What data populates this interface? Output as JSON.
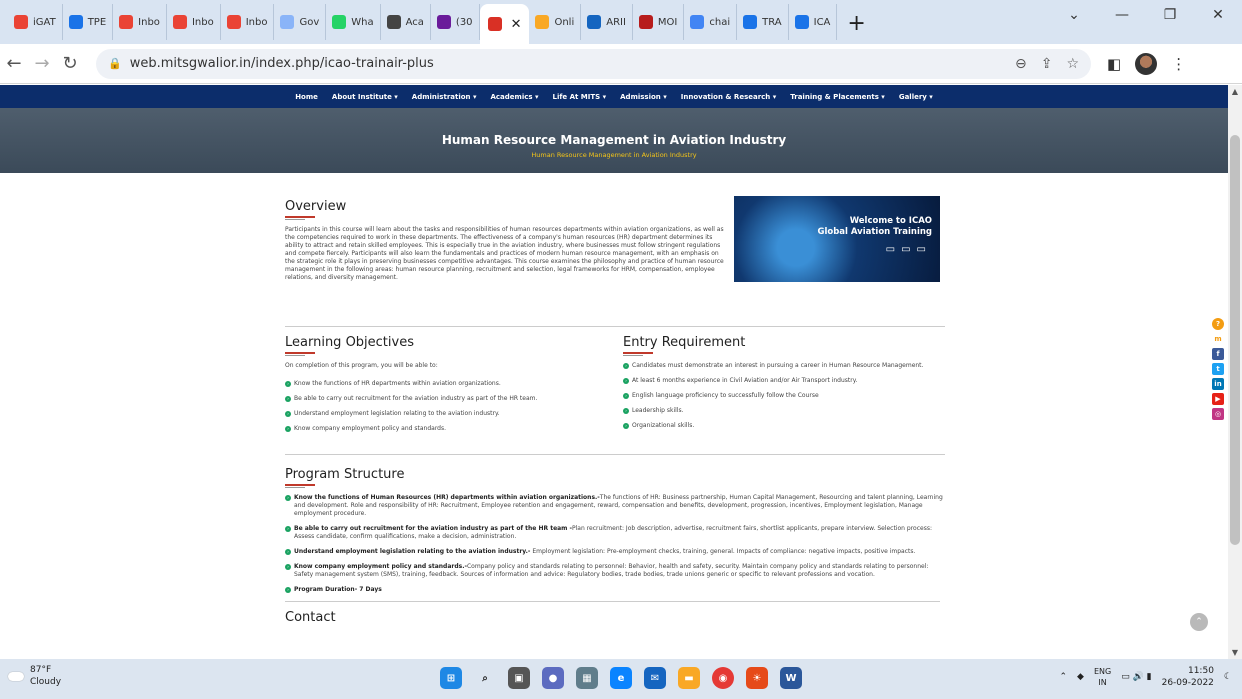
{
  "browser": {
    "tabs": [
      {
        "label": "iGAT",
        "icon": "gmail-icon",
        "color": "#ea4335"
      },
      {
        "label": "TPE",
        "icon": "site-icon",
        "color": "#1a73e8"
      },
      {
        "label": "Inbo",
        "icon": "gmail-icon",
        "color": "#ea4335"
      },
      {
        "label": "Inbo",
        "icon": "gmail-icon",
        "color": "#ea4335"
      },
      {
        "label": "Inbo",
        "icon": "gmail-icon",
        "color": "#ea4335"
      },
      {
        "label": "Gov",
        "icon": "site-icon",
        "color": "#8ab4f8"
      },
      {
        "label": "Wha",
        "icon": "whatsapp-icon",
        "color": "#25d366"
      },
      {
        "label": "Aca",
        "icon": "site-icon",
        "color": "#444"
      },
      {
        "label": "(30",
        "icon": "mail-icon",
        "color": "#6a1b9a"
      }
    ],
    "active_tab": {
      "label": "",
      "icon": "opera-icon",
      "color": "#d93025"
    },
    "tabs_after": [
      {
        "label": "Onli",
        "icon": "site-icon",
        "color": "#f9a825"
      },
      {
        "label": "ARII",
        "icon": "site-icon",
        "color": "#1565c0"
      },
      {
        "label": "MOI",
        "icon": "site-icon",
        "color": "#b71c1c"
      },
      {
        "label": "chai",
        "icon": "google-icon",
        "color": "#4285f4"
      },
      {
        "label": "TRA",
        "icon": "site-icon",
        "color": "#1a73e8"
      },
      {
        "label": "ICA",
        "icon": "site-icon",
        "color": "#1a73e8"
      }
    ],
    "url": "web.mitsgwalior.in/index.php/icao-trainair-plus"
  },
  "site": {
    "nav": [
      "Home",
      "About Institute ▾",
      "Administration ▾",
      "Academics ▾",
      "Life At MITS ▾",
      "Admission ▾",
      "Innovation & Research ▾",
      "Training & Placements ▾",
      "Gallery ▾"
    ],
    "hero_title": "Human Resource Management in Aviation Industry",
    "hero_crumb": "Human Resource Management in Aviation Industry",
    "overview_title": "Overview",
    "overview_text": "Participants in this course will learn about the tasks and responsibilities of human resources departments within aviation organizations, as well as the competencies required to work in these departments. The effectiveness of a company's human resources (HR) department determines its ability to attract and retain skilled employees. This is especially true in the aviation industry, where businesses must follow stringent regulations and compete fiercely. Participants will also learn the fundamentals and practices of modern human resource management, with an emphasis on the strategic role it plays in preserving businesses competitive advantages. This course examines the philosophy and practice of human resource management in the following areas: human resource planning, recruitment and selection, legal frameworks for HRM, compensation, employee relations, and diversity management.",
    "banner": {
      "line1": "Welcome to ICAO",
      "line2": "Global Aviation Training"
    },
    "objectives_title": "Learning Objectives",
    "objectives_intro": "On completion of this program, you will be able to:",
    "objectives": [
      "Know the functions of HR departments within aviation organizations.",
      "Be able to carry out recruitment for the aviation industry as part of the HR team.",
      "Understand employment legislation relating to the aviation industry.",
      "Know company employment policy and standards."
    ],
    "entry_title": "Entry Requirement",
    "entry": [
      "Candidates must demonstrate an interest in pursuing a career in Human Resource Management.",
      "At least 6 months experience in Civil Aviation and/or Air Transport industry.",
      "English language proficiency to successfully follow the Course",
      "Leadership skills.",
      "Organizational skills."
    ],
    "program_title": "Program Structure",
    "program": [
      {
        "head": "Know the functions of Human Resources (HR) departments within aviation organizations.-",
        "text": "The functions of HR: Business partnership, Human Capital Management, Resourcing and talent planning, Learning and development. Role and responsibility of HR: Recruitment, Employee retention and engagement, reward, compensation and benefits, development, progression, incentives, Employment legislation, Manage employment procedure."
      },
      {
        "head": "Be able to carry out recruitment for the aviation industry as part of the HR team -",
        "text": "Plan recruitment: Job description, advertise, recruitment fairs, shortlist applicants, prepare interview. Selection process: Assess candidate, confirm qualifications, make a decision, administration."
      },
      {
        "head": "Understand employment legislation relating to the aviation industry.-",
        "text": " Employment legislation: Pre-employment checks, training, general. Impacts of compliance: negative impacts, positive impacts."
      },
      {
        "head": "Know company employment policy and standards.-",
        "text": "Company policy and standards relating to personnel: Behavior, health and safety, security. Maintain company policy and standards relating to personnel: Safety management system (SMS), training, feedback. Sources of information and advice: Regulatory bodies, trade bodies, trade unions generic or specific to relevant professions and vocation."
      }
    ],
    "duration": "Program Duration- 7 Days",
    "contact_title": "Contact"
  },
  "taskbar": {
    "temp": "87°F",
    "weather": "Cloudy",
    "lang1": "ENG",
    "lang2": "IN",
    "time": "11:50",
    "date": "26-09-2022"
  }
}
